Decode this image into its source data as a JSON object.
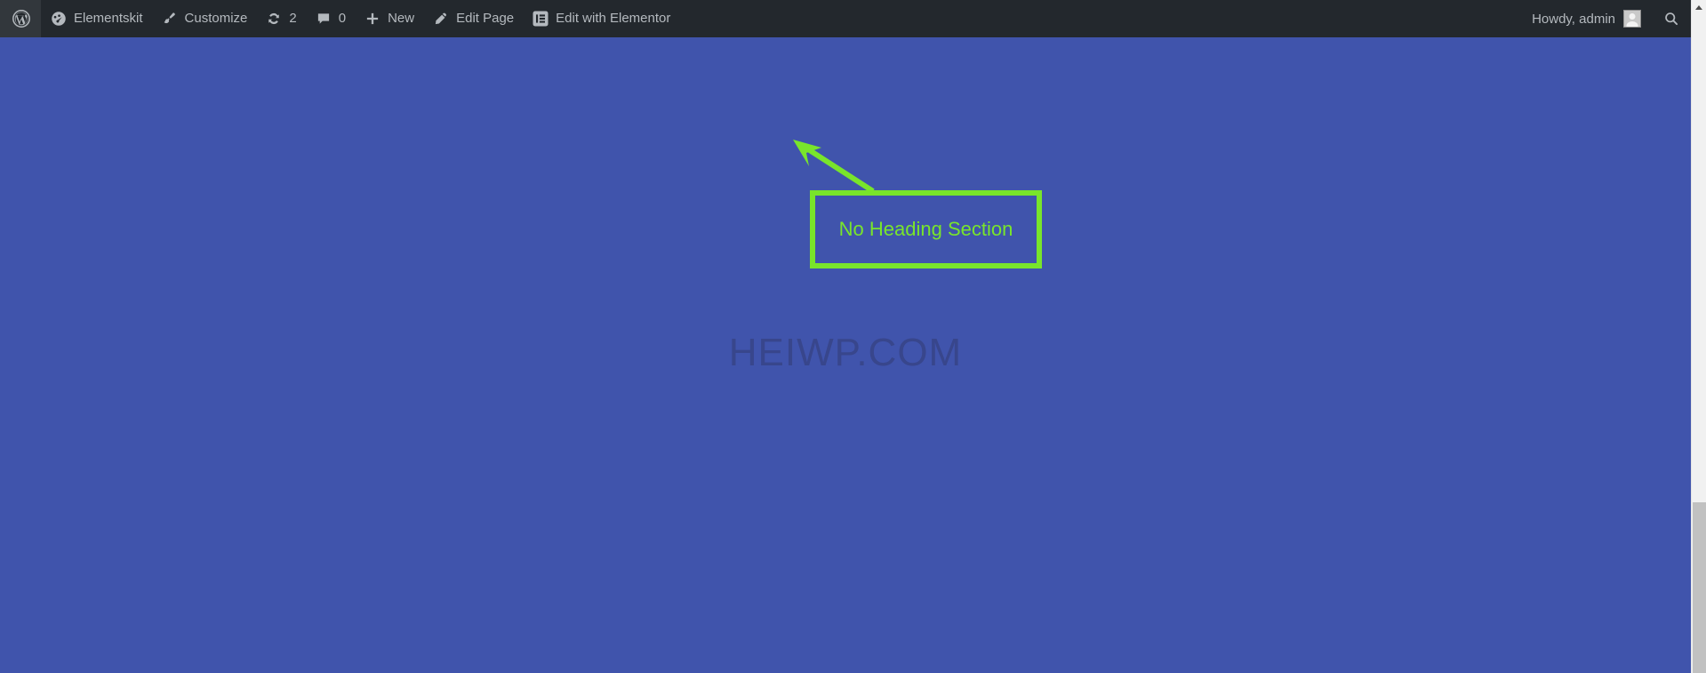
{
  "adminbar": {
    "wp_logo_icon": "wordpress-logo-icon",
    "items": [
      {
        "id": "elementskit",
        "icon": "dashboard-gauge-icon",
        "label": "Elementskit"
      },
      {
        "id": "customize",
        "icon": "paintbrush-icon",
        "label": "Customize"
      },
      {
        "id": "updates",
        "icon": "update-arrows-icon",
        "label": "2"
      },
      {
        "id": "comments",
        "icon": "comment-bubble-icon",
        "label": "0"
      },
      {
        "id": "new-content",
        "icon": "plus-icon",
        "label": "New"
      },
      {
        "id": "edit-page",
        "icon": "pencil-icon",
        "label": "Edit Page"
      },
      {
        "id": "edit-with-elementor",
        "icon": "elementor-icon",
        "label": "Edit with Elementor"
      }
    ],
    "howdy": "Howdy, admin",
    "avatar_icon": "user-avatar-icon",
    "search_icon": "search-icon"
  },
  "page": {
    "background_color": "#4054ac",
    "watermark": "HEIWP.COM",
    "watermark_color": "#38468c"
  },
  "annotation": {
    "color": "#79e52b",
    "label": "No Heading Section",
    "arrow_icon": "arrow-up-left-icon"
  },
  "scrollbar": {
    "up_arrow_icon": "scroll-up-arrow-icon",
    "thumb_color": "#c1c1c1",
    "track_color": "#f1f1f1"
  }
}
